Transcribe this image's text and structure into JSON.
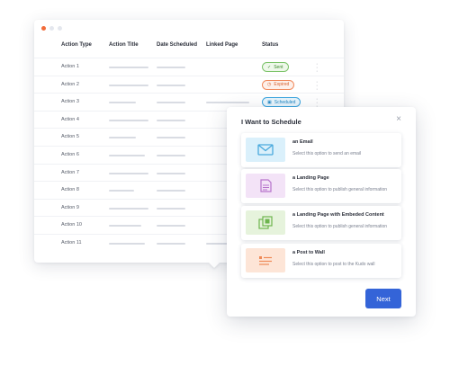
{
  "table": {
    "headers": [
      "Action Type",
      "Action Title",
      "Date Scheduled",
      "Linked Page",
      "Status"
    ],
    "rows": [
      {
        "name": "Action 1",
        "status": "Sent",
        "status_type": "sent"
      },
      {
        "name": "Action 2",
        "status": "Expired",
        "status_type": "expired"
      },
      {
        "name": "Action 3",
        "status": "Scheduled",
        "status_type": "scheduled"
      },
      {
        "name": "Action 4"
      },
      {
        "name": "Action 5"
      },
      {
        "name": "Action 6"
      },
      {
        "name": "Action 7"
      },
      {
        "name": "Action 8"
      },
      {
        "name": "Action 9"
      },
      {
        "name": "Action 10"
      },
      {
        "name": "Action 11"
      }
    ]
  },
  "modal": {
    "title": "I Want to Schedule",
    "next_label": "Next",
    "options": [
      {
        "title": "an Email",
        "description": "Select this option to send an email",
        "icon": "envelope-icon",
        "color": "#daf0fb",
        "accent": "#4aa9dd"
      },
      {
        "title": "a Landing Page",
        "description": "Select this option to publish general information",
        "icon": "document-icon",
        "color": "#f3e3f7",
        "accent": "#b774cc"
      },
      {
        "title": "a Landing Page with Embeded Content",
        "description": "Select this option to publish general information",
        "icon": "embedded-pages-icon",
        "color": "#e6f3dc",
        "accent": "#6db54e"
      },
      {
        "title": "a Post to Wall",
        "description": "Select this option to post to the Kudo wall",
        "icon": "post-list-icon",
        "color": "#fde5d7",
        "accent": "#ef8a57"
      }
    ]
  },
  "colors": {
    "primary": "#3464d8",
    "sent": "#7cc36a",
    "expired": "#f08a5d",
    "scheduled": "#3ba5df"
  }
}
